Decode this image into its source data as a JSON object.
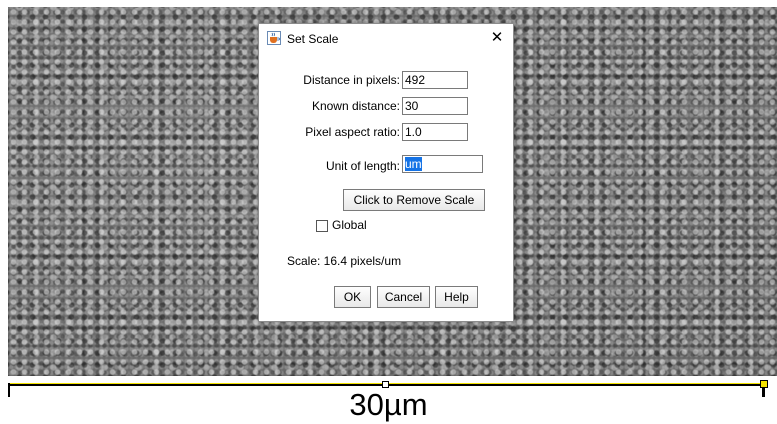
{
  "image": {
    "scale_label": "30µm"
  },
  "dialog": {
    "title": "Set Scale",
    "icon": "java-cup-icon",
    "close_label": "✕",
    "fields": {
      "distance_in_pixels": {
        "label": "Distance in pixels:",
        "value": "492"
      },
      "known_distance": {
        "label": "Known distance:",
        "value": "30"
      },
      "pixel_aspect_ratio": {
        "label": "Pixel aspect ratio:",
        "value": "1.0"
      },
      "unit_of_length": {
        "label": "Unit of length:",
        "value": "um"
      }
    },
    "remove_scale_button": "Click to Remove Scale",
    "global_checkbox": {
      "label": "Global",
      "checked": false
    },
    "scale_info": "Scale: 16.4 pixels/um",
    "buttons": {
      "ok": "OK",
      "cancel": "Cancel",
      "help": "Help"
    }
  },
  "colors": {
    "selection": "#1573e6",
    "scale_bar_highlight": "#f3e200"
  }
}
